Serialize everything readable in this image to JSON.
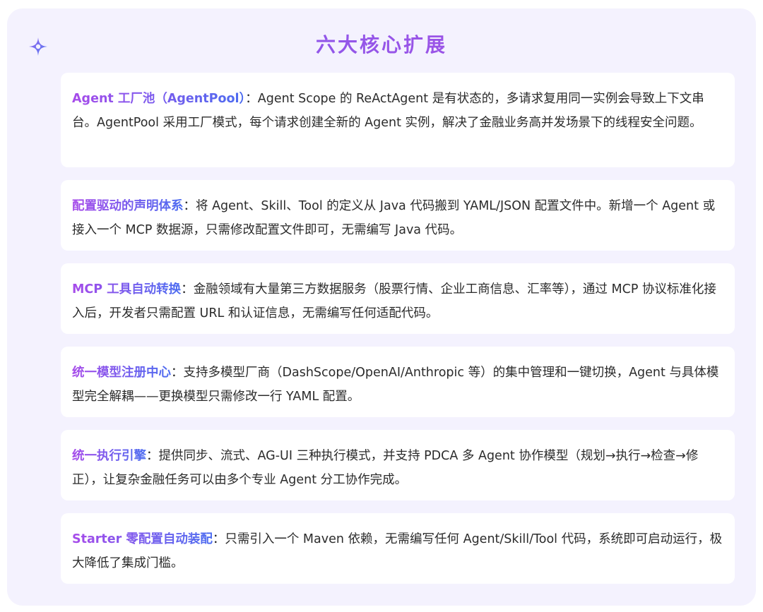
{
  "title": "六大核心扩展",
  "colors": {
    "panel_bg": "#f4f2fe",
    "card_bg": "#ffffff",
    "accent_start": "#a74bea",
    "accent_end": "#4b6cf0",
    "title": "#8a4fe8"
  },
  "icon": "sparkle-icon",
  "items": [
    {
      "heading": "Agent 工厂池（AgentPool）",
      "sep": "：",
      "text": "Agent Scope 的 ReActAgent 是有状态的，多请求复用同一实例会导致上下文串台。AgentPool 采用工厂模式，每个请求创建全新的 Agent 实例，解决了金融业务高并发场景下的线程安全问题。"
    },
    {
      "heading": "配置驱动的声明体系",
      "sep": "：",
      "text": "将 Agent、Skill、Tool 的定义从 Java 代码搬到 YAML/JSON 配置文件中。新增一个 Agent 或接入一个 MCP 数据源，只需修改配置文件即可，无需编写 Java 代码。"
    },
    {
      "heading": "MCP 工具自动转换",
      "sep": "：",
      "text": "金融领域有大量第三方数据服务（股票行情、企业工商信息、汇率等），通过 MCP 协议标准化接入后，开发者只需配置 URL 和认证信息，无需编写任何适配代码。"
    },
    {
      "heading": "统一模型注册中心",
      "sep": "：",
      "text": "支持多模型厂商（DashScope/OpenAI/Anthropic 等）的集中管理和一键切换，Agent 与具体模型完全解耦——更换模型只需修改一行 YAML 配置。"
    },
    {
      "heading": "统一执行引擎",
      "sep": "：",
      "text": "提供同步、流式、AG-UI 三种执行模式，并支持 PDCA 多 Agent 协作模型（规划→执行→检查→修正），让复杂金融任务可以由多个专业 Agent 分工协作完成。"
    },
    {
      "heading": "Starter 零配置自动装配",
      "sep": "：",
      "text": "只需引入一个 Maven 依赖，无需编写任何 Agent/Skill/Tool 代码，系统即可启动运行，极大降低了集成门槛。"
    }
  ]
}
